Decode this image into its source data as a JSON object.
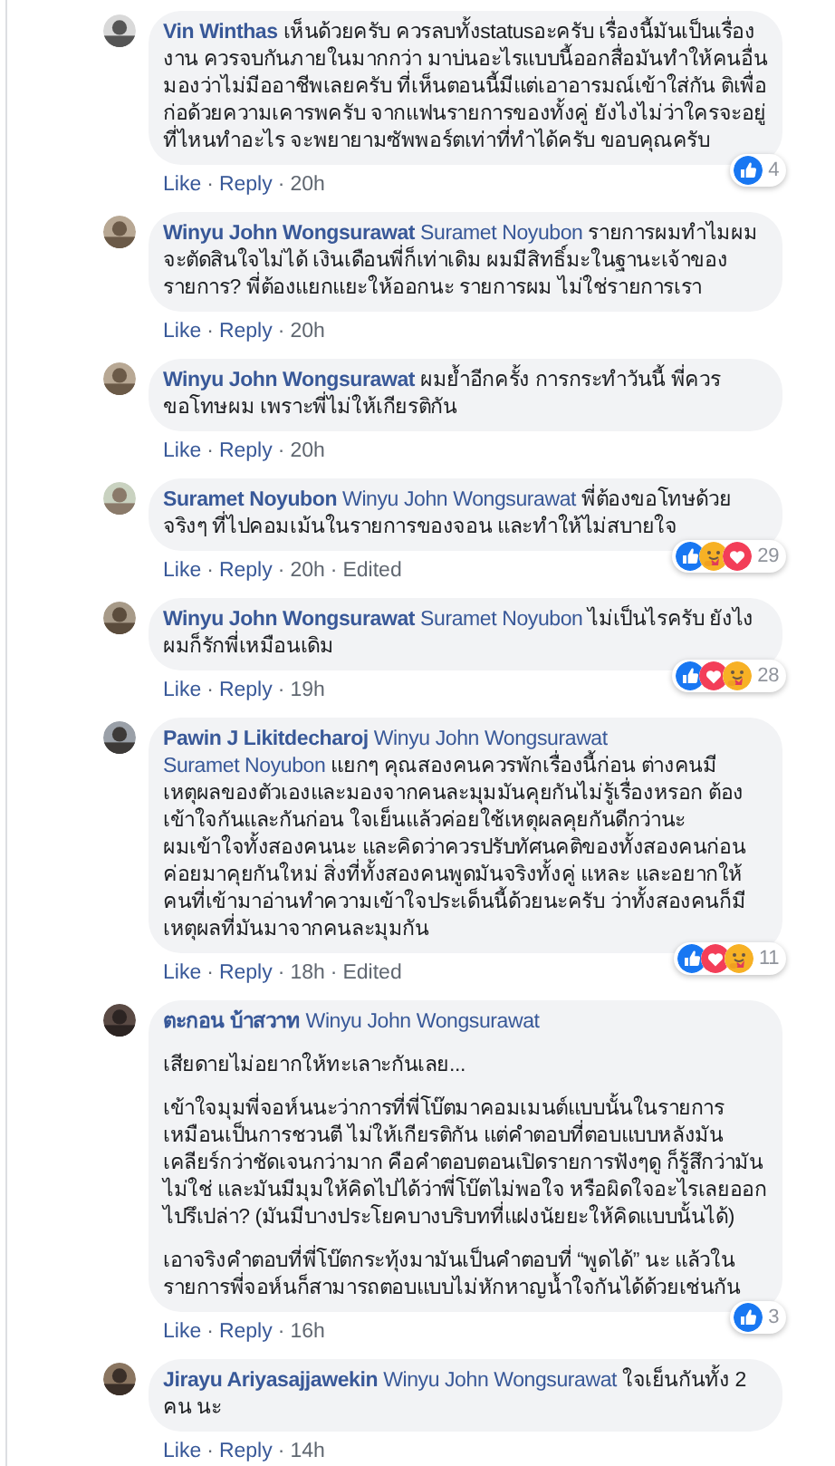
{
  "separator": "·",
  "comments": [
    {
      "author": "Vin Winthas",
      "text": "เห็นด้วยครับ ควรลบทั้งstatusอะครับ เรื่องนี้มันเป็นเรื่องงาน ควรจบกันภายในมากกว่า มาบ่นอะไรแบบนี้ออกสื่อมันทำให้คนอื่นมองว่าไม่มีออาชีพเลยครับ ที่เห็นตอนนี้มีแต่เอาอารมณ์เข้าใส่กัน ติเพื่อก่อด้วยความเคารพครับ จากแฟนรายการของทั้งคู่ ยังไงไม่ว่าใครจะอยู่ที่ไหนทำอะไร จะพยายามซัพพอร์ตเท่าที่ทำได้ครับ ขอบคุณครับ",
      "reactions": [
        {
          "kind": "like"
        }
      ],
      "reaction_count": "4",
      "actions": [
        "Like",
        "Reply"
      ],
      "time": "20h"
    },
    {
      "author": "Winyu John Wongsurawat",
      "mentions": [
        "Suramet Noyubon"
      ],
      "text": "รายการผมทำไมผมจะตัดสินใจไม่ได้ เงินเดือนพี่ก็เท่าเดิม ผมมีสิทธิ์มะในฐานะเจ้าของรายการ? พี่ต้องแยกแยะให้ออกนะ รายการผม ไม่ใช่รายการเรา",
      "actions": [
        "Like",
        "Reply"
      ],
      "time": "20h"
    },
    {
      "author": "Winyu John Wongsurawat",
      "text": "ผมย้ำอีกครั้ง การกระทำวันนี้ พี่ควรขอโทษผม เพราะพี่ไม่ให้เกียรติกัน",
      "actions": [
        "Like",
        "Reply"
      ],
      "time": "20h"
    },
    {
      "author": "Suramet Noyubon",
      "mentions": [
        "Winyu John Wongsurawat"
      ],
      "text": "พี่ต้องขอโทษด้วยจริงๆ ที่ไปคอมเม้นในรายการของจอน และทำให้ไม่สบายใจ",
      "reactions": [
        {
          "kind": "like"
        },
        {
          "kind": "care"
        },
        {
          "kind": "love"
        }
      ],
      "reaction_count": "29",
      "actions": [
        "Like",
        "Reply"
      ],
      "time": "20h",
      "edited": "Edited"
    },
    {
      "author": "Winyu John Wongsurawat",
      "mentions": [
        "Suramet Noyubon"
      ],
      "text": "ไม่เป็นไรครับ ยังไงผมก็รักพี่เหมือนเดิม",
      "reactions": [
        {
          "kind": "like"
        },
        {
          "kind": "love"
        },
        {
          "kind": "care"
        }
      ],
      "reaction_count": "28",
      "actions": [
        "Like",
        "Reply"
      ],
      "time": "19h"
    },
    {
      "author": "Pawin J Likitdecharoj",
      "mentions": [
        "Winyu John Wongsurawat",
        "Suramet Noyubon"
      ],
      "text": "แยกๆ คุณสองคนควรพักเรื่องนี้ก่อน ต่างคนมีเหตุผลของตัวเองและมองจากคนละมุมมันคุยกันไม่รู้เรื่องหรอก ต้องเข้าใจกันและกันก่อน ใจเย็นแล้วค่อยใช้เหตุผลคุยกันดีกว่านะ\nผมเข้าใจทั้งสองคนนะ และคิดว่าควรปรับทัศนคติของทั้งสองคนก่อนค่อยมาคุยกันใหม่ สิ่งที่ทั้งสองคนพูดมันจริงทั้งคู่ แหละ และอยากให้คนที่เข้ามาอ่านทำความเข้าใจประเด็นนี้ด้วยนะครับ ว่าทั้งสองคนก็มีเหตุผลที่มันมาจากคนละมุมกัน",
      "reactions": [
        {
          "kind": "like"
        },
        {
          "kind": "love"
        },
        {
          "kind": "care"
        }
      ],
      "reaction_count": "11",
      "actions": [
        "Like",
        "Reply"
      ],
      "time": "18h",
      "edited": "Edited"
    },
    {
      "author": "ตะกอน บ้าสวาท",
      "mentions": [
        "Winyu John Wongsurawat"
      ],
      "paragraphs": [
        "เสียดายไม่อยากให้ทะเลาะกันเลย...",
        "เข้าใจมุมพี่จอห์นนะว่าการที่พี่โบ๊ตมาคอมเมนต์แบบนั้นในรายการเหมือนเป็นการชวนตี ไม่ให้เกียรติกัน แต่คำตอบที่ตอบแบบหลังมันเคลียร์กว่าชัดเจนกว่ามาก คือคำตอบตอนเปิดรายการฟังๆดู ก็รู้สึกว่ามันไม่ใช่ และมันมีมุมให้คิดไปได้ว่าพี่โบ๊ตไม่พอใจ หรือผิดใจอะไรเลยออกไปรึเปล่า? (มันมีบางประโยคบางบริบทที่แฝงนัยยะให้คิดแบบนั้นได้)",
        "เอาจริงคำตอบที่พี่โบ๊ตกระทุ้งมามันเป็นคำตอบที่ “พูดได้” นะ แล้วในรายการพี่จอห์นก็สามารถตอบแบบไม่หักหาญน้ำใจกันได้ด้วยเช่นกัน"
      ],
      "reactions": [
        {
          "kind": "like"
        }
      ],
      "reaction_count": "3",
      "actions": [
        "Like",
        "Reply"
      ],
      "time": "16h"
    },
    {
      "author": "Jirayu Ariyasajjawekin",
      "mentions": [
        "Winyu John Wongsurawat"
      ],
      "text": "ใจเย็นกันทั้ง 2 คน นะ",
      "actions": [
        "Like",
        "Reply"
      ],
      "time": "14h"
    }
  ]
}
